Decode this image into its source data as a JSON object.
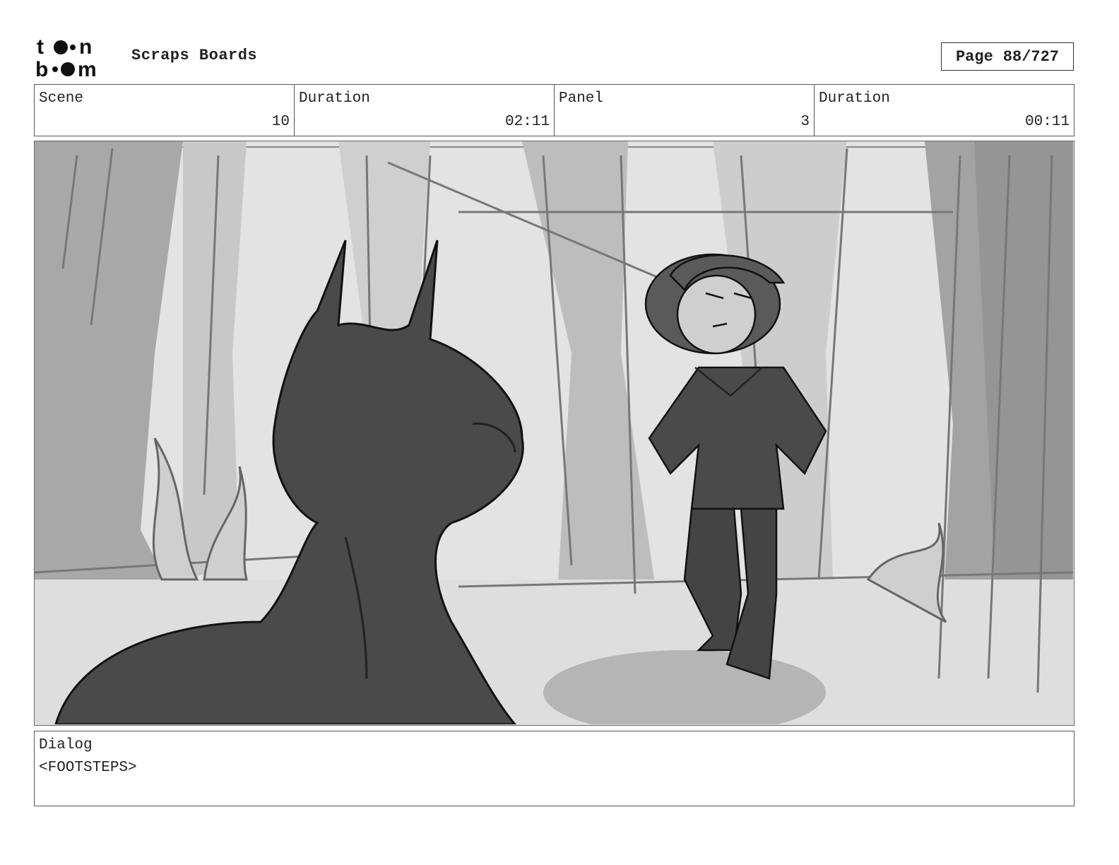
{
  "header": {
    "logo_text": "toon boom",
    "title": "Scraps Boards",
    "page_label": "Page",
    "page_value": "88/727"
  },
  "info": [
    {
      "label": "Scene",
      "value": "10"
    },
    {
      "label": "Duration",
      "value": "02:11"
    },
    {
      "label": "Panel",
      "value": "3"
    },
    {
      "label": "Duration",
      "value": "00:11"
    }
  ],
  "panel": {
    "image_icon": "storyboard-sketch"
  },
  "dialog": {
    "label": "Dialog",
    "text": "<FOOTSTEPS>"
  }
}
